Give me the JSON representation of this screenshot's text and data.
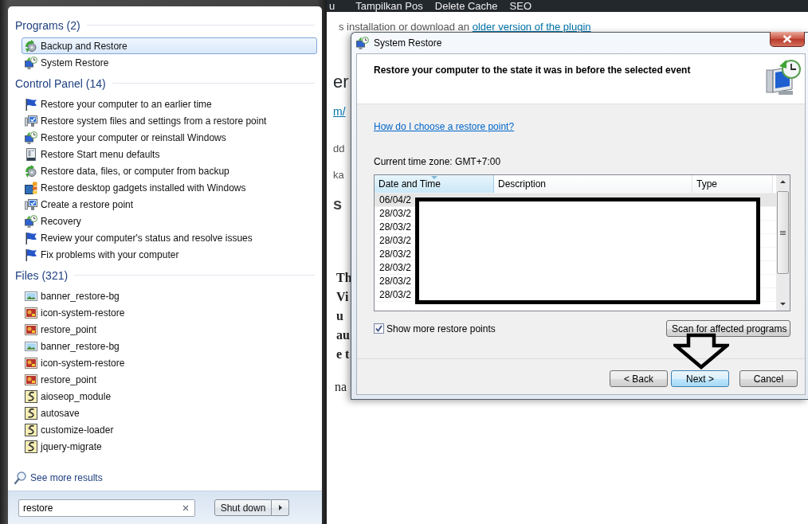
{
  "start_menu": {
    "groups": [
      {
        "title": "Programs (2)",
        "items": [
          {
            "label": "Backup and Restore",
            "kind": "backup",
            "selected": true
          },
          {
            "label": "System Restore",
            "kind": "restore",
            "selected": false
          }
        ]
      },
      {
        "title": "Control Panel (14)",
        "items": [
          {
            "label": "Restore your computer to an earlier time",
            "kind": "flag",
            "selected": false
          },
          {
            "label": "Restore system files and settings from a restore point",
            "kind": "monitor",
            "selected": false
          },
          {
            "label": "Restore your computer or reinstall Windows",
            "kind": "restore",
            "selected": false
          },
          {
            "label": "Restore Start menu defaults",
            "kind": "taskbar",
            "selected": false
          },
          {
            "label": "Restore data, files, or computer from backup",
            "kind": "backup",
            "selected": false
          },
          {
            "label": "Restore desktop gadgets installed with Windows",
            "kind": "gadget",
            "selected": false
          },
          {
            "label": "Create a restore point",
            "kind": "monitor",
            "selected": false
          },
          {
            "label": "Recovery",
            "kind": "restore",
            "selected": false
          },
          {
            "label": "Review your computer's status and resolve issues",
            "kind": "flag",
            "selected": false
          },
          {
            "label": "Fix problems with your computer",
            "kind": "flag",
            "selected": false
          }
        ]
      },
      {
        "title": "Files (321)",
        "items": [
          {
            "label": "banner_restore-bg",
            "kind": "image",
            "selected": false
          },
          {
            "label": "icon-system-restore",
            "kind": "photo",
            "selected": false
          },
          {
            "label": "restore_point",
            "kind": "photo",
            "selected": false
          },
          {
            "label": "banner_restore-bg",
            "kind": "image",
            "selected": false
          },
          {
            "label": "icon-system-restore",
            "kind": "photo",
            "selected": false
          },
          {
            "label": "restore_point",
            "kind": "photo",
            "selected": false
          },
          {
            "label": "aioseop_module",
            "kind": "script",
            "selected": false
          },
          {
            "label": "autosave",
            "kind": "script",
            "selected": false
          },
          {
            "label": "customize-loader",
            "kind": "script",
            "selected": false
          },
          {
            "label": "jquery-migrate",
            "kind": "script",
            "selected": false
          }
        ]
      }
    ],
    "see_more": "See more results",
    "search": {
      "value": "restore"
    },
    "shutdown": "Shut down"
  },
  "background_page": {
    "menu": [
      "u",
      "Tampilkan Pos",
      "Delete Cache",
      "SEO"
    ],
    "notice": {
      "text": "s installation or download an",
      "link": "older version of the plugin"
    },
    "fragments": [
      {
        "text": "er",
        "kind": "heading"
      },
      {
        "text": "m/",
        "kind": "link"
      },
      {
        "text": "dd",
        "kind": "plain"
      },
      {
        "text": "ka",
        "kind": "plain"
      },
      {
        "text": "s",
        "kind": "title"
      },
      {
        "text": "Th",
        "kind": "strong"
      },
      {
        "text": "Vi",
        "kind": "strong"
      },
      {
        "text": "u",
        "kind": "strong"
      },
      {
        "text": "au",
        "kind": "strong"
      },
      {
        "text": "e t",
        "kind": "strong"
      },
      {
        "text": "na",
        "kind": "body"
      }
    ]
  },
  "dialog": {
    "title": "System Restore",
    "heading": "Restore your computer to the state it was in before the selected event",
    "help_link": "How do I choose a restore point?",
    "time_zone": "Current time zone: GMT+7:00",
    "table": {
      "columns": [
        {
          "label": "Date and Time",
          "sorted": true
        },
        {
          "label": "Description",
          "sorted": false
        },
        {
          "label": "Type",
          "sorted": false
        }
      ],
      "rows": [
        {
          "date": "06/04/2",
          "selected": true
        },
        {
          "date": "28/03/2",
          "selected": false
        },
        {
          "date": "28/03/2",
          "selected": false
        },
        {
          "date": "28/03/2",
          "selected": false
        },
        {
          "date": "28/03/2",
          "selected": false
        },
        {
          "date": "28/03/2",
          "selected": false
        },
        {
          "date": "28/03/2",
          "selected": false
        },
        {
          "date": "28/03/2",
          "selected": false
        }
      ]
    },
    "show_more": {
      "label": "Show more restore points",
      "checked": true
    },
    "scan_button": "Scan for affected programs",
    "buttons": [
      {
        "label": "< Back",
        "default": false
      },
      {
        "label": "Next >",
        "default": true
      },
      {
        "label": "Cancel",
        "default": false
      }
    ]
  }
}
